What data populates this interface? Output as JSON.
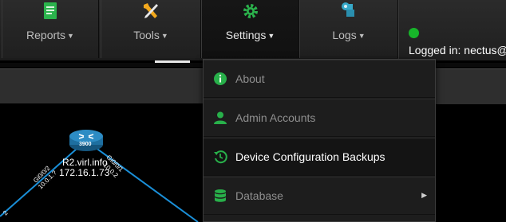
{
  "nav": {
    "reports": {
      "label": "Reports",
      "icon": "report-document-icon"
    },
    "tools": {
      "label": "Tools",
      "icon": "wrench-screwdriver-icon"
    },
    "settings": {
      "label": "Settings",
      "icon": "gear-icon"
    },
    "logs": {
      "label": "Logs",
      "icon": "logs-scroll-icon"
    }
  },
  "status": {
    "logged_in_text": "Logged in: nectus@",
    "status_color": "#17b52a"
  },
  "settings_menu": {
    "items": [
      {
        "label": "About",
        "icon": "info-icon"
      },
      {
        "label": "Admin Accounts",
        "icon": "user-icon"
      },
      {
        "label": "Device Configuration Backups",
        "icon": "history-icon"
      },
      {
        "label": "Database",
        "icon": "database-icon",
        "has_submenu": true
      }
    ]
  },
  "topology": {
    "router": {
      "badge": "3900",
      "hostname": "R2.virl.info",
      "ip": "172.16.1.73"
    },
    "links": {
      "left_iface": "Gi0/0/2",
      "left_ip": "10.0.1.?",
      "right_iface": "Gi0/0/1",
      "right_ip": "10.0.2",
      "bottom_left_ip": "2"
    }
  },
  "colors": {
    "accent_green": "#28b04a",
    "link_blue": "#1a8fd8",
    "router_blue": "#1e6fa0"
  }
}
